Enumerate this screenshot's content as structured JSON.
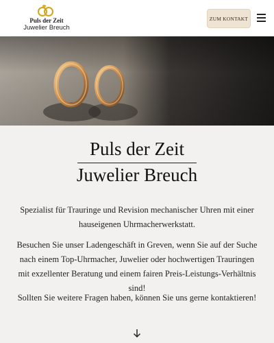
{
  "header": {
    "logo_line1": "Puls der Zeit",
    "logo_line2": "Juwelier Breuch",
    "cta_label": "ZUM KONTAKT",
    "menu_icon": "hamburger-menu-icon"
  },
  "hero": {
    "image_icon": "wedding-rings-photo"
  },
  "main": {
    "title_line1": "Puls der Zeit",
    "title_line2": "Juwelier Breuch",
    "paragraph1": "Spezialist für Trauringe und Revision mechanischer Uhren mit einer hauseigenen Uhrmacherwerkstatt.",
    "paragraph2": "Besuchen Sie unser Ladengeschäft in Greven, wenn Sie auf der Suche nach einem Top-Uhrmacher, Juwelier oder hochwertigen Trauringen mit exzellenter Beratung und einem fairen Preis-Leistungs-Verhältnis sind!",
    "paragraph3": "Sollten Sie weitere Fragen haben, können Sie uns gerne kontaktieren!",
    "scroll_icon": "arrow-down-icon"
  },
  "colors": {
    "background": "#f2f1ef",
    "header_bg": "#ffffff",
    "cta_bg": "#efe4d3",
    "gold": "#c9a227"
  }
}
